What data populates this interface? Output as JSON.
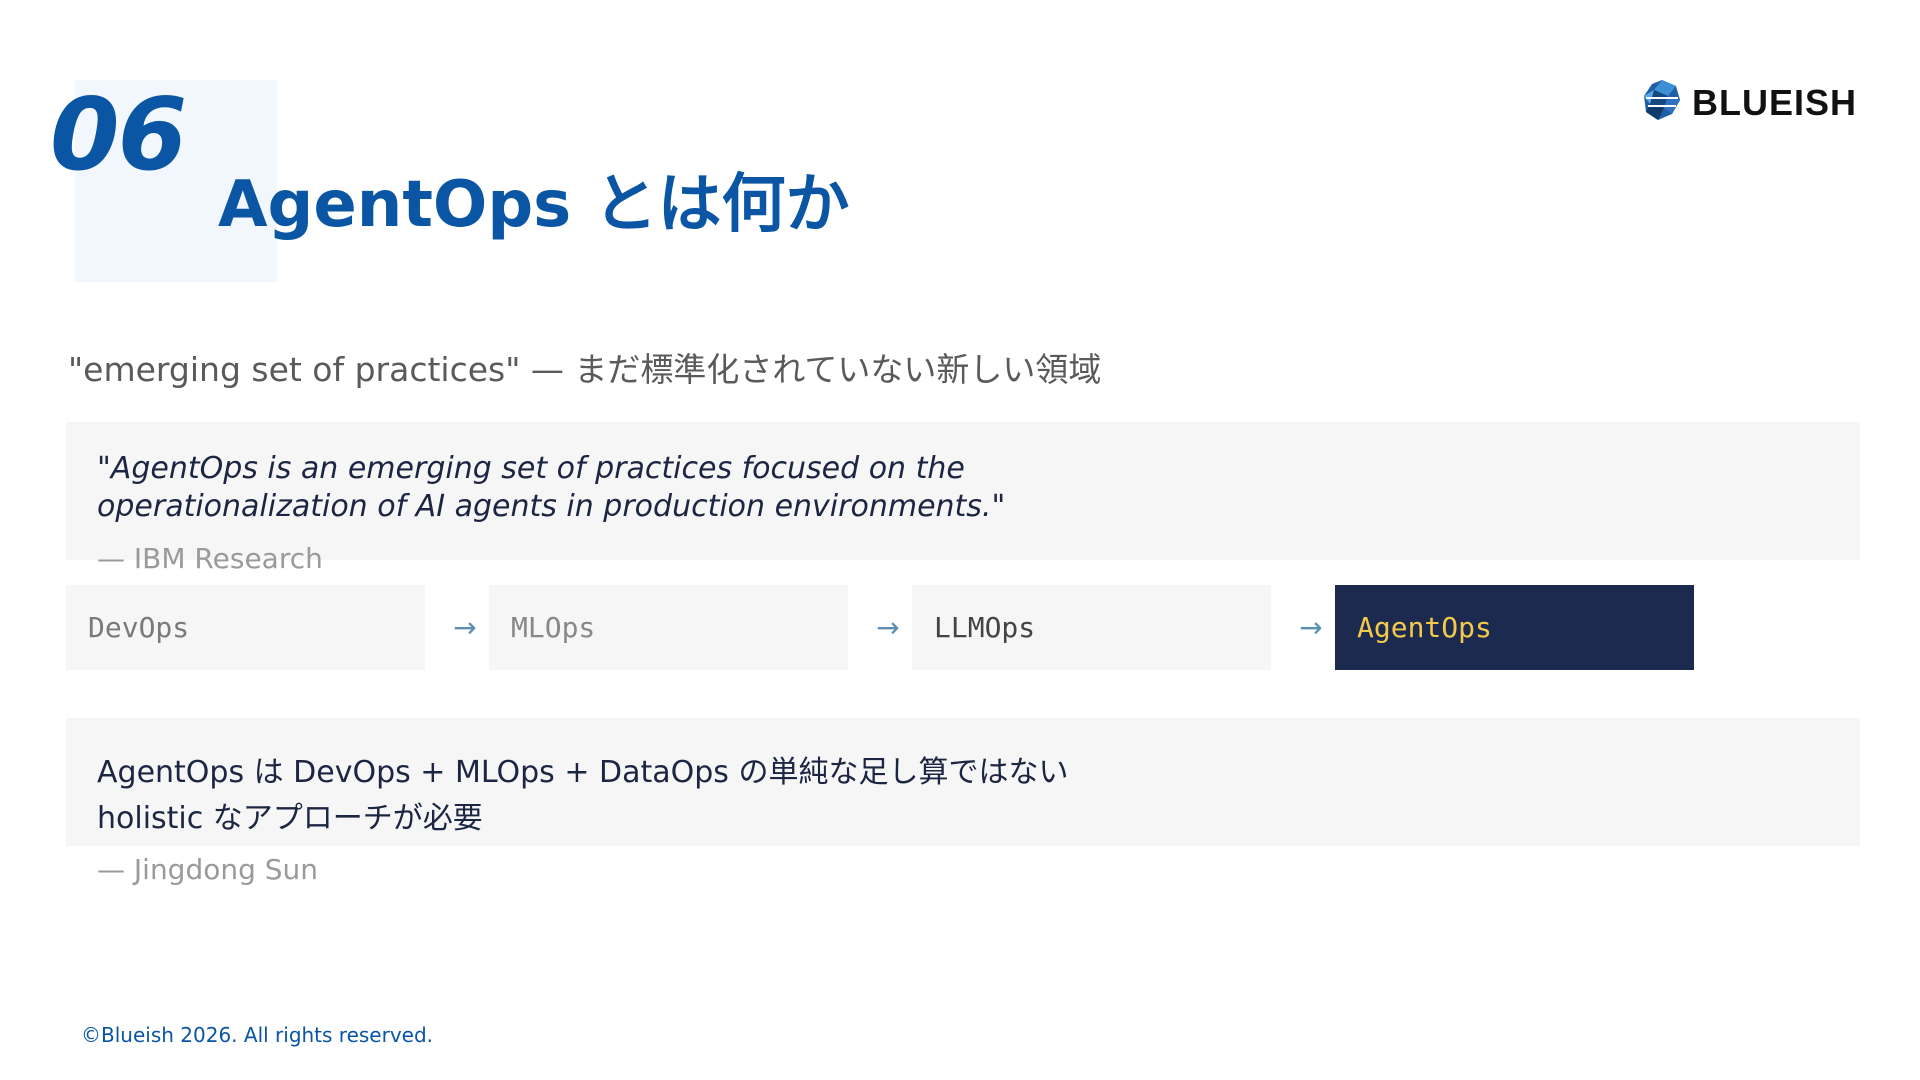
{
  "section": {
    "number": "06",
    "title": "AgentOps とは何か"
  },
  "logo": {
    "text": "BLUEISH",
    "icon": "blueish-logo-icon"
  },
  "subtitle": "\"emerging set of practices\" — まだ標準化されていない新しい領域",
  "quote": {
    "text": "\"AgentOps is an emerging set of practices focused on the operationalization of AI agents in production environments.\"",
    "attribution": "— IBM Research"
  },
  "flow": {
    "steps": [
      "DevOps",
      "MLOps",
      "LLMOps",
      "AgentOps"
    ],
    "arrow": "→",
    "highlighted": "AgentOps"
  },
  "note": {
    "line1": "AgentOps は DevOps + MLOps + DataOps の単純な足し算ではない",
    "line2": "holistic なアプローチが必要",
    "attribution": "— Jingdong Sun"
  },
  "footer": "©Blueish 2026. All rights reserved.",
  "colors": {
    "accent": "#0a55a4",
    "dark_navy": "#1b2a4e",
    "highlight_text": "#f3c94b",
    "box_bg": "#f6f6f7",
    "arrow": "#5b8fb3"
  }
}
